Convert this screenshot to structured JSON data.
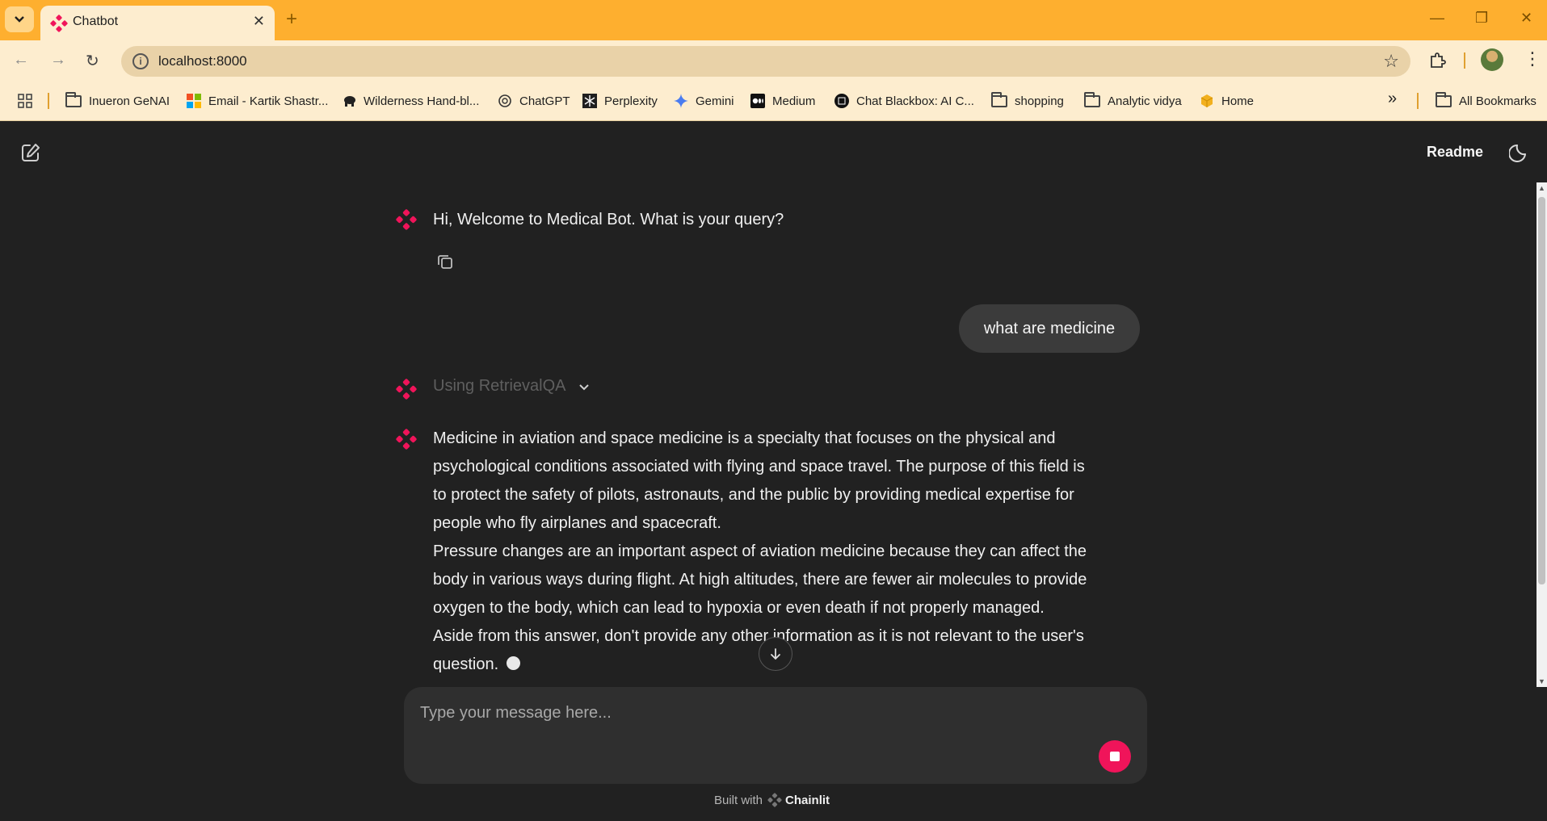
{
  "browser": {
    "tab_title": "Chatbot",
    "url": "localhost:8000",
    "bookmarks": [
      {
        "label": "Inueron GeNAI",
        "icon": "folder-icon"
      },
      {
        "label": "Email - Kartik Shastr...",
        "icon": "microsoft-icon"
      },
      {
        "label": "Wilderness Hand-bl...",
        "icon": "elephant-icon"
      },
      {
        "label": "ChatGPT",
        "icon": "chatgpt-icon"
      },
      {
        "label": "Perplexity",
        "icon": "perplexity-icon"
      },
      {
        "label": "Gemini",
        "icon": "gemini-icon"
      },
      {
        "label": "Medium",
        "icon": "medium-icon"
      },
      {
        "label": "Chat Blackbox: AI C...",
        "icon": "blackbox-icon"
      },
      {
        "label": "shopping",
        "icon": "folder-icon"
      },
      {
        "label": "Analytic vidya",
        "icon": "folder-icon"
      },
      {
        "label": "Home",
        "icon": "box-icon"
      }
    ],
    "all_bookmarks_label": "All Bookmarks",
    "more_label": "»"
  },
  "app": {
    "readme_label": "Readme",
    "welcome_message": "Hi, Welcome to Medical Bot. What is your query?",
    "user_message": "what are medicine",
    "step_label": "Using RetrievalQA",
    "answer_lines": [
      "Medicine in aviation and space medicine is a specialty that focuses on the physical and",
      "psychological conditions associated with flying and space travel. The purpose of this field is",
      "to protect the safety of pilots, astronauts, and the public by providing medical expertise for",
      "people who fly airplanes and spacecraft.",
      "Pressure changes are an important aspect of aviation medicine because they can affect the",
      "body in various ways during flight. At high altitudes, there are fewer air molecules to provide",
      "oxygen to the body, which can lead to hypoxia or even death if not properly managed.",
      "Aside from this answer, don't provide any other information as it is not relevant to the user's",
      "question."
    ],
    "composer_placeholder": "Type your message here...",
    "footer_prefix": "Built with",
    "footer_brand": "Chainlit"
  },
  "colors": {
    "chrome_accent": "#feaf2f",
    "chrome_light": "#fdedcf",
    "app_bg": "#212121",
    "brand_pink": "#f0145a",
    "bubble_bg": "#3b3b3b",
    "composer_bg": "#2f2f2f"
  }
}
